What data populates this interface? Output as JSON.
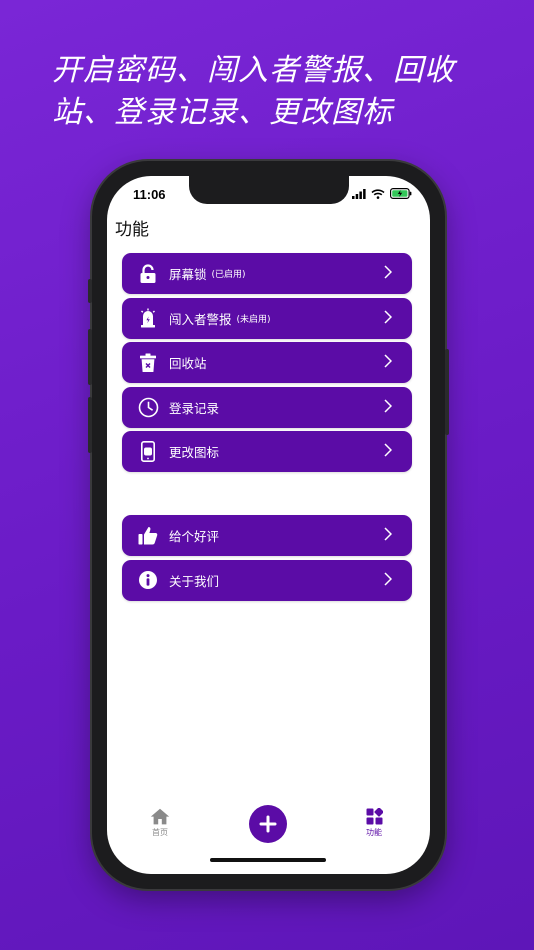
{
  "headline": "开启密码、闯入者警报、回收站、登录记录、更改图标",
  "status": {
    "time": "11:06"
  },
  "page_title": "功能",
  "menu_primary": [
    {
      "label": "屏幕锁",
      "sub": "(已启用)",
      "icon": "lock-icon"
    },
    {
      "label": "闯入者警报",
      "sub": "(未启用)",
      "icon": "alarm-light-icon"
    },
    {
      "label": "回收站",
      "sub": "",
      "icon": "trash-icon"
    },
    {
      "label": "登录记录",
      "sub": "",
      "icon": "clock-icon"
    },
    {
      "label": "更改图标",
      "sub": "",
      "icon": "phone-icon"
    }
  ],
  "menu_secondary": [
    {
      "label": "给个好评",
      "sub": "",
      "icon": "thumbs-up-icon"
    },
    {
      "label": "关于我们",
      "sub": "",
      "icon": "info-icon"
    }
  ],
  "tabs": {
    "home": "首页",
    "features": "功能"
  },
  "colors": {
    "accent": "#5b0ca6",
    "background": "#6a1bc6"
  }
}
